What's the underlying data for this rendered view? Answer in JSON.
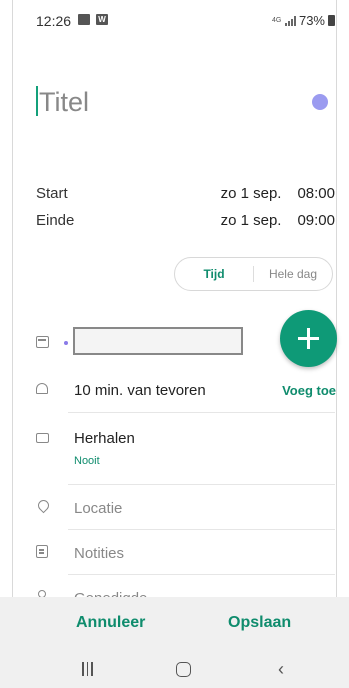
{
  "status_bar": {
    "time": "12:26",
    "network": "4G",
    "battery": "73%"
  },
  "title": {
    "placeholder": "Titel"
  },
  "start": {
    "label": "Start",
    "date": "zo 1 sep.",
    "time": "08:00"
  },
  "end": {
    "label": "Einde",
    "date": "zo 1 sep.",
    "time": "09:00"
  },
  "toggle": {
    "time_label": "Tijd",
    "all_day_label": "Hele dag"
  },
  "reminder": {
    "text": "10 min. van tevoren",
    "add_label": "Voeg toe"
  },
  "repeat": {
    "label": "Herhalen",
    "value": "Nooit"
  },
  "location": {
    "placeholder": "Locatie"
  },
  "notes": {
    "placeholder": "Notities"
  },
  "invitees": {
    "placeholder": "Genodigde"
  },
  "actions": {
    "cancel_label": "Annuleer",
    "save_label": "Opslaan"
  },
  "colors": {
    "accent": "#0e9a77",
    "event_color": "#9b9bf0"
  },
  "icons": [
    "calendar-icon",
    "bell-icon",
    "repeat-icon",
    "location-pin-icon",
    "notes-icon",
    "person-icon",
    "plus-icon"
  ]
}
